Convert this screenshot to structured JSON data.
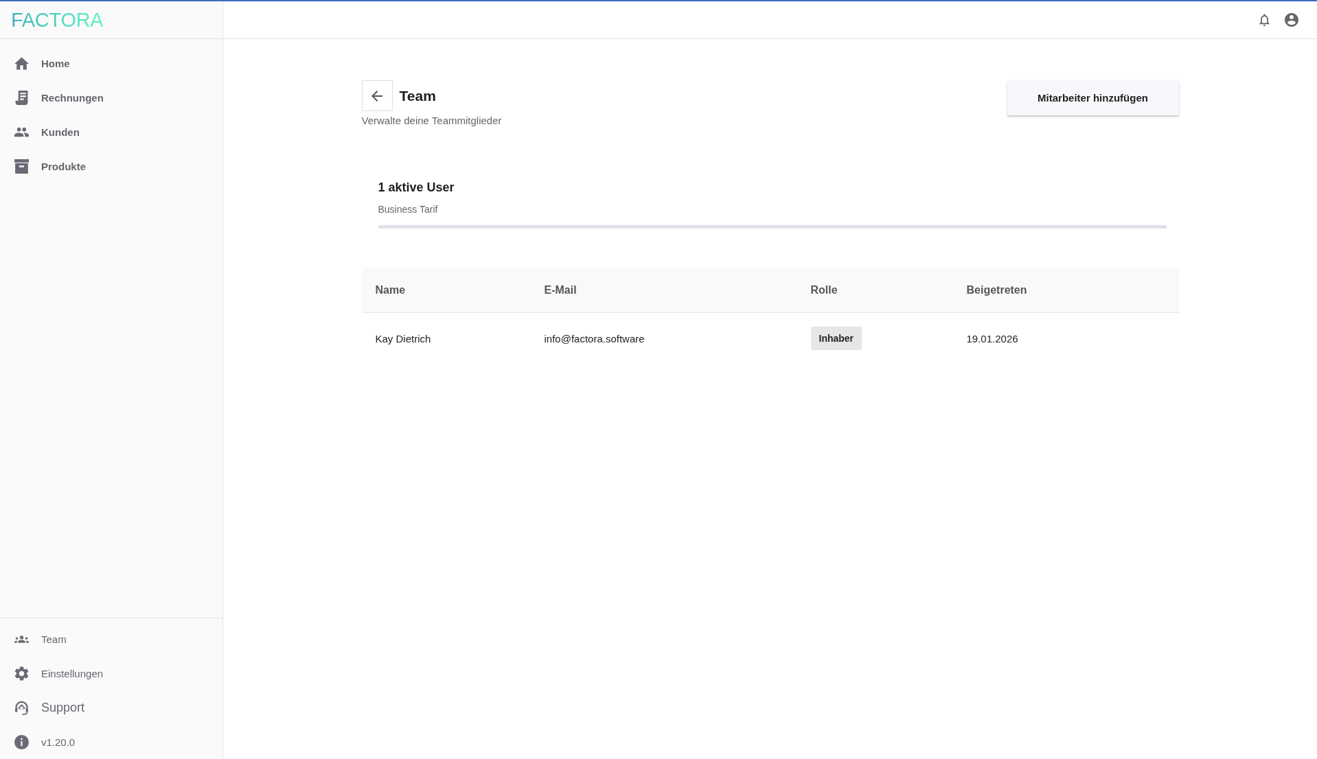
{
  "sidebar": {
    "logo": "FACTORA",
    "nav_items": [
      {
        "label": "Home"
      },
      {
        "label": "Rechnungen"
      },
      {
        "label": "Kunden"
      },
      {
        "label": "Produkte"
      }
    ],
    "footer_items": [
      {
        "label": "Team"
      },
      {
        "label": "Einstellungen"
      },
      {
        "label": "Support"
      },
      {
        "label": "v1.20.0"
      }
    ]
  },
  "page": {
    "title": "Team",
    "subtitle": "Verwalte deine Teammitglieder",
    "action_button": "Mitarbeiter hinzufügen"
  },
  "plan": {
    "title": "1 aktive User",
    "subtitle": "Business Tarif",
    "level": 0
  },
  "table": {
    "columns": [
      "Name",
      "E-Mail",
      "Rolle",
      "Beigetreten"
    ],
    "rows": [
      {
        "name": "Kay Dietrich",
        "email": "info@factora.software",
        "role": "Inhaber",
        "joined": "19.01.2026"
      }
    ]
  }
}
